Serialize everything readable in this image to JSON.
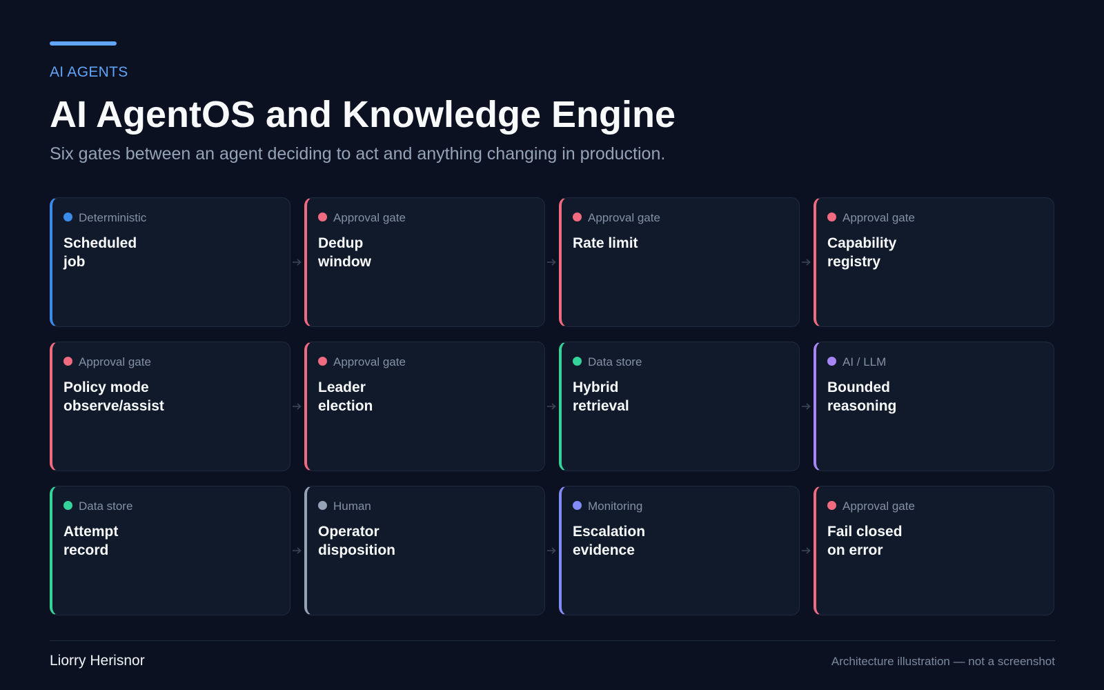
{
  "header": {
    "eyebrow": "AI AGENTS",
    "title": "AI AgentOS and Knowledge Engine",
    "subtitle": "Six gates between an agent deciding to act and anything changing in production."
  },
  "cards": [
    {
      "kind": "Deterministic",
      "label": "Scheduled\njob",
      "color": "#3b8beb",
      "icon": "dot"
    },
    {
      "kind": "Approval gate",
      "label": "Dedup\nwindow",
      "color": "#f06a80",
      "icon": "dot"
    },
    {
      "kind": "Approval gate",
      "label": "Rate limit",
      "color": "#f06a80",
      "icon": "dot"
    },
    {
      "kind": "Approval gate",
      "label": "Capability\nregistry",
      "color": "#f06a80",
      "icon": "dot"
    },
    {
      "kind": "Approval gate",
      "label": "Policy mode\nobserve/assist",
      "color": "#f06a80",
      "icon": "dot"
    },
    {
      "kind": "Approval gate",
      "label": "Leader\nelection",
      "color": "#f06a80",
      "icon": "dot"
    },
    {
      "kind": "Data store",
      "label": "Hybrid\nretrieval",
      "color": "#34d399",
      "icon": "dot"
    },
    {
      "kind": "AI / LLM",
      "label": "Bounded\nreasoning",
      "color": "#a685f5",
      "icon": "dot"
    },
    {
      "kind": "Data store",
      "label": "Attempt\nrecord",
      "color": "#34d399",
      "icon": "dot"
    },
    {
      "kind": "Human",
      "label": "Operator\ndisposition",
      "color": "#94a3b8",
      "icon": "dot"
    },
    {
      "kind": "Monitoring",
      "label": "Escalation\nevidence",
      "color": "#818cf8",
      "icon": "dot"
    },
    {
      "kind": "Approval gate",
      "label": "Fail closed\non error",
      "color": "#f06a80",
      "icon": "dot"
    }
  ],
  "colors": {
    "background": "#0b1120",
    "card": "#111a2b",
    "accent": "#60a5fa",
    "arrow": "#3a4659"
  },
  "footer": {
    "author": "Liorry Herisnor",
    "disclaimer": "Architecture illustration — not a screenshot"
  }
}
